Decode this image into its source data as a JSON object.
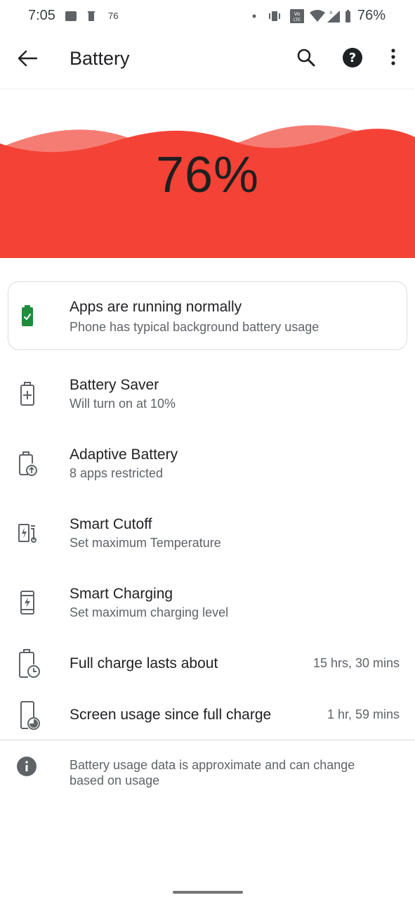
{
  "status_bar": {
    "time": "7:05",
    "notification_count": "76",
    "battery_percent": "76%",
    "icons": [
      "gallery-icon",
      "trash-icon",
      "dot-icon",
      "vibrate-icon",
      "volte-icon",
      "wifi-icon",
      "signal-icon",
      "battery-icon"
    ]
  },
  "app_bar": {
    "title": "Battery",
    "icons": [
      "back-arrow-icon",
      "search-icon",
      "help-icon",
      "more-vert-icon"
    ]
  },
  "hero": {
    "level_text": "76%",
    "level": 0.76,
    "color_main": "#f44336",
    "color_wave": "#f57c73"
  },
  "status_card": {
    "title": "Apps are running normally",
    "subtitle": "Phone has typical background battery usage",
    "icon": "battery-check-icon",
    "icon_color": "#1e8e3e"
  },
  "settings": [
    {
      "title": "Battery Saver",
      "subtitle": "Will turn on at 10%",
      "icon": "battery-plus-icon"
    },
    {
      "title": "Adaptive Battery",
      "subtitle": "8 apps restricted",
      "icon": "battery-adaptive-icon"
    },
    {
      "title": "Smart Cutoff",
      "subtitle": "Set maximum Temperature",
      "icon": "smart-cutoff-icon"
    },
    {
      "title": "Smart Charging",
      "subtitle": "Set maximum charging level",
      "icon": "smart-charging-icon"
    }
  ],
  "stats": [
    {
      "label": "Full charge lasts about",
      "value": "15 hrs, 30 mins",
      "icon": "battery-clock-icon"
    },
    {
      "label": "Screen usage since full charge",
      "value": "1 hr, 59 mins",
      "icon": "phone-usage-icon"
    }
  ],
  "footer": {
    "text": "Battery usage data is approximate and can change based on usage",
    "icon": "info-icon"
  }
}
